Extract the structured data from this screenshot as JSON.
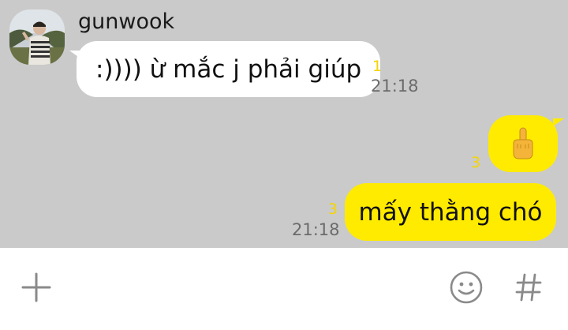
{
  "conversation": {
    "contact": {
      "name": "gunwook",
      "avatar_icon": "person-photo-avatar"
    },
    "messages": [
      {
        "direction": "incoming",
        "text": ":)))) ừ mắc j phải giúp",
        "unread": "1",
        "time": "21:18"
      },
      {
        "direction": "outgoing",
        "type": "emoji",
        "emoji_icon": "middle-finger-emoji-icon",
        "unread": "3"
      },
      {
        "direction": "outgoing",
        "type": "text",
        "text": "mấy thằng chó",
        "unread": "3",
        "time": "21:18"
      }
    ]
  },
  "input_bar": {
    "plus_icon": "plus-icon",
    "message_placeholder": "",
    "emoji_icon": "smiley-icon",
    "hash_icon": "hash-icon"
  },
  "colors": {
    "chat_background": "#cacaca",
    "incoming_bubble": "#ffffff",
    "outgoing_bubble": "#ffeb00",
    "unread_count": "#f5d400",
    "timestamp": "#6b6b6b",
    "icon_gray": "#8a8a8a"
  }
}
